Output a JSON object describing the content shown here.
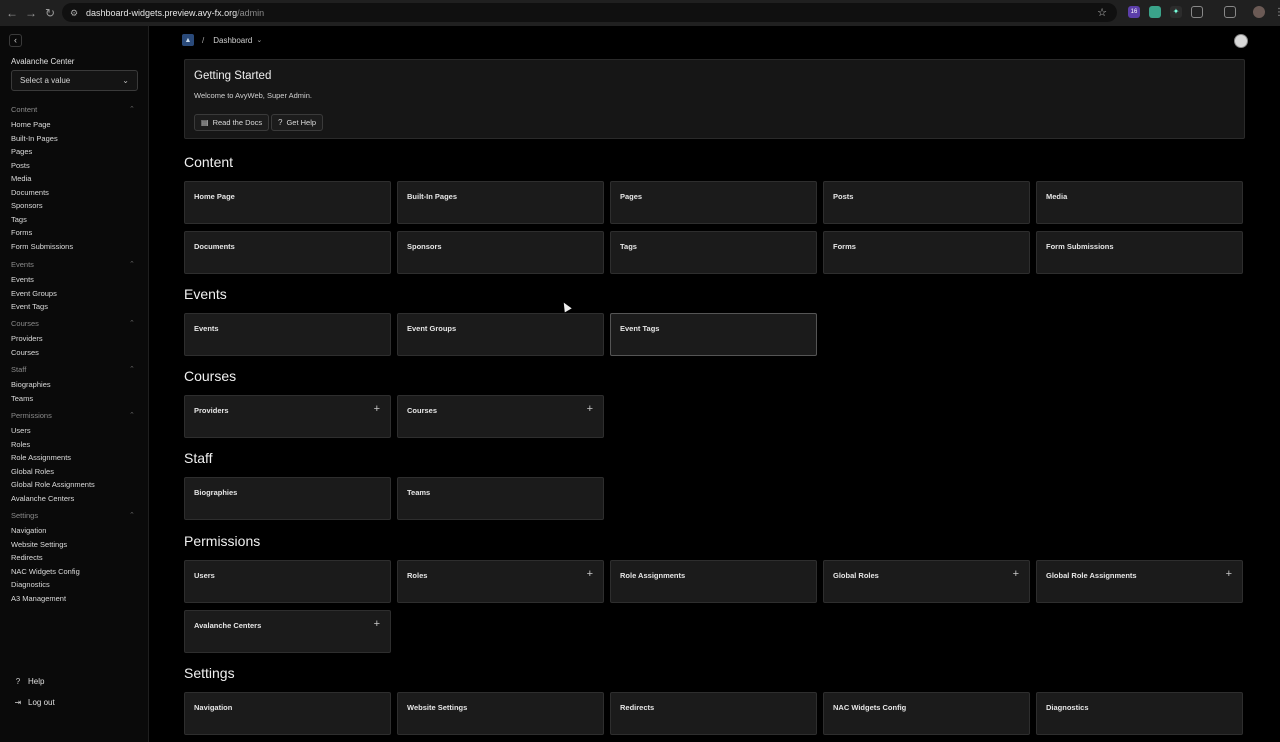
{
  "browser": {
    "url_host": "dashboard-widgets.preview.avy-fx.org",
    "url_path": "/admin",
    "ext_badge": "16"
  },
  "sidebar": {
    "center_label": "Avalanche Center",
    "select_placeholder": "Select a value",
    "groups": [
      {
        "title": "Content",
        "items": [
          "Home Page",
          "Built-In Pages",
          "Pages",
          "Posts",
          "Media",
          "Documents",
          "Sponsors",
          "Tags",
          "Forms",
          "Form Submissions"
        ]
      },
      {
        "title": "Events",
        "items": [
          "Events",
          "Event Groups",
          "Event Tags"
        ]
      },
      {
        "title": "Courses",
        "items": [
          "Providers",
          "Courses"
        ]
      },
      {
        "title": "Staff",
        "items": [
          "Biographies",
          "Teams"
        ]
      },
      {
        "title": "Permissions",
        "items": [
          "Users",
          "Roles",
          "Role Assignments",
          "Global Roles",
          "Global Role Assignments",
          "Avalanche Centers"
        ]
      },
      {
        "title": "Settings",
        "items": [
          "Navigation",
          "Website Settings",
          "Redirects",
          "NAC Widgets Config",
          "Diagnostics",
          "A3 Management"
        ]
      }
    ],
    "footer": {
      "help": "Help",
      "logout": "Log out"
    }
  },
  "header": {
    "breadcrumb": "Dashboard"
  },
  "getting_started": {
    "title": "Getting Started",
    "subtitle": "Welcome to AvyWeb, Super Admin.",
    "docs_button": "Read the Docs",
    "help_button": "Get Help"
  },
  "sections": [
    {
      "title": "Content",
      "cards": [
        {
          "label": "Home Page",
          "plus": false
        },
        {
          "label": "Built-In Pages",
          "plus": false
        },
        {
          "label": "Pages",
          "plus": false
        },
        {
          "label": "Posts",
          "plus": false
        },
        {
          "label": "Media",
          "plus": false
        },
        {
          "label": "Documents",
          "plus": false
        },
        {
          "label": "Sponsors",
          "plus": false
        },
        {
          "label": "Tags",
          "plus": false
        },
        {
          "label": "Forms",
          "plus": false
        },
        {
          "label": "Form Submissions",
          "plus": false
        }
      ]
    },
    {
      "title": "Events",
      "cards": [
        {
          "label": "Events",
          "plus": false
        },
        {
          "label": "Event Groups",
          "plus": false
        },
        {
          "label": "Event Tags",
          "plus": false
        }
      ]
    },
    {
      "title": "Courses",
      "cards": [
        {
          "label": "Providers",
          "plus": true
        },
        {
          "label": "Courses",
          "plus": true
        }
      ]
    },
    {
      "title": "Staff",
      "cards": [
        {
          "label": "Biographies",
          "plus": false
        },
        {
          "label": "Teams",
          "plus": false
        }
      ]
    },
    {
      "title": "Permissions",
      "cards": [
        {
          "label": "Users",
          "plus": false
        },
        {
          "label": "Roles",
          "plus": true
        },
        {
          "label": "Role Assignments",
          "plus": false
        },
        {
          "label": "Global Roles",
          "plus": true
        },
        {
          "label": "Global Role Assignments",
          "plus": true
        },
        {
          "label": "Avalanche Centers",
          "plus": true
        }
      ]
    },
    {
      "title": "Settings",
      "cards": [
        {
          "label": "Navigation",
          "plus": false
        },
        {
          "label": "Website Settings",
          "plus": false
        },
        {
          "label": "Redirects",
          "plus": false
        },
        {
          "label": "NAC Widgets Config",
          "plus": false
        },
        {
          "label": "Diagnostics",
          "plus": false
        }
      ]
    }
  ],
  "colors": {
    "background": "#000000",
    "card": "#1b1b1b",
    "border": "#2e2e2e"
  }
}
